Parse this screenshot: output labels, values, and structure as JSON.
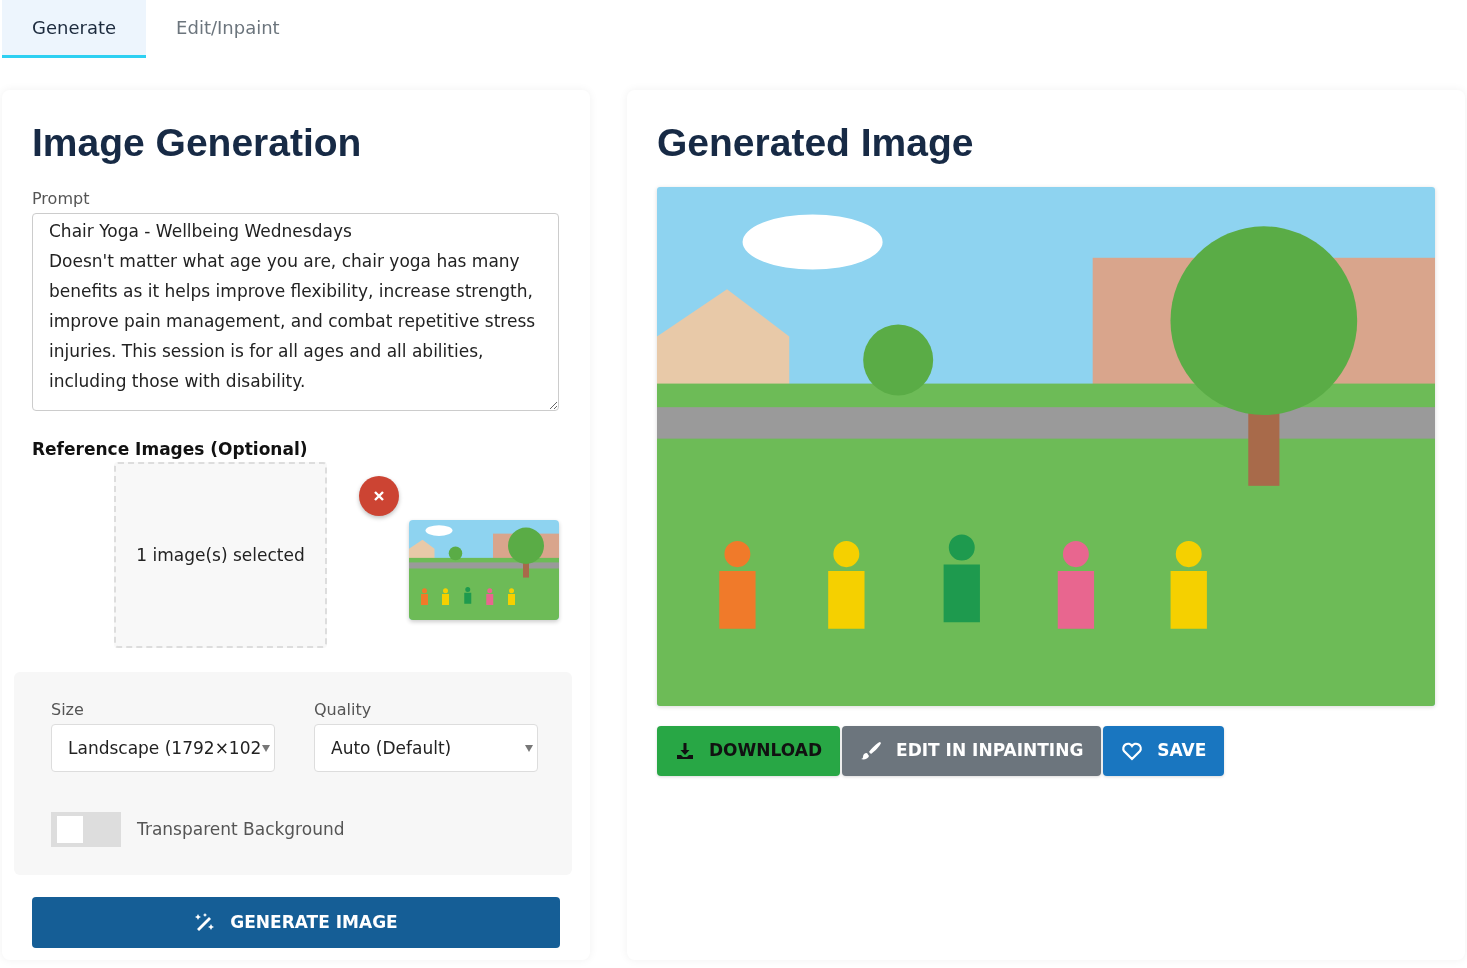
{
  "tabs": [
    {
      "label": "Generate",
      "selected": true
    },
    {
      "label": "Edit/Inpaint",
      "selected": false
    }
  ],
  "generation": {
    "title": "Image Generation",
    "prompt": {
      "label": "Prompt",
      "value": "Chair Yoga - Wellbeing Wednesdays\nDoesn't matter what age you are, chair yoga has many benefits as it helps improve flexibility, increase strength, improve pain management, and combat repetitive stress injuries. This session is for all ages and all abilities, including those with disability."
    },
    "reference": {
      "label": "Reference Images (Optional)",
      "dropzone": "1 image(s) selected"
    },
    "settings": {
      "size": {
        "label": "Size",
        "value": "Landscape (1792×102"
      },
      "quality": {
        "label": "Quality",
        "value": "Auto (Default)"
      },
      "transparent": {
        "label": "Transparent Background",
        "on": false
      }
    },
    "button": "GENERATE IMAGE"
  },
  "result": {
    "title": "Generated Image",
    "actions": [
      {
        "kind": "download",
        "label": "DOWNLOAD"
      },
      {
        "kind": "edit",
        "label": "EDIT IN INPAINTING"
      },
      {
        "kind": "save",
        "label": "SAVE"
      }
    ]
  }
}
